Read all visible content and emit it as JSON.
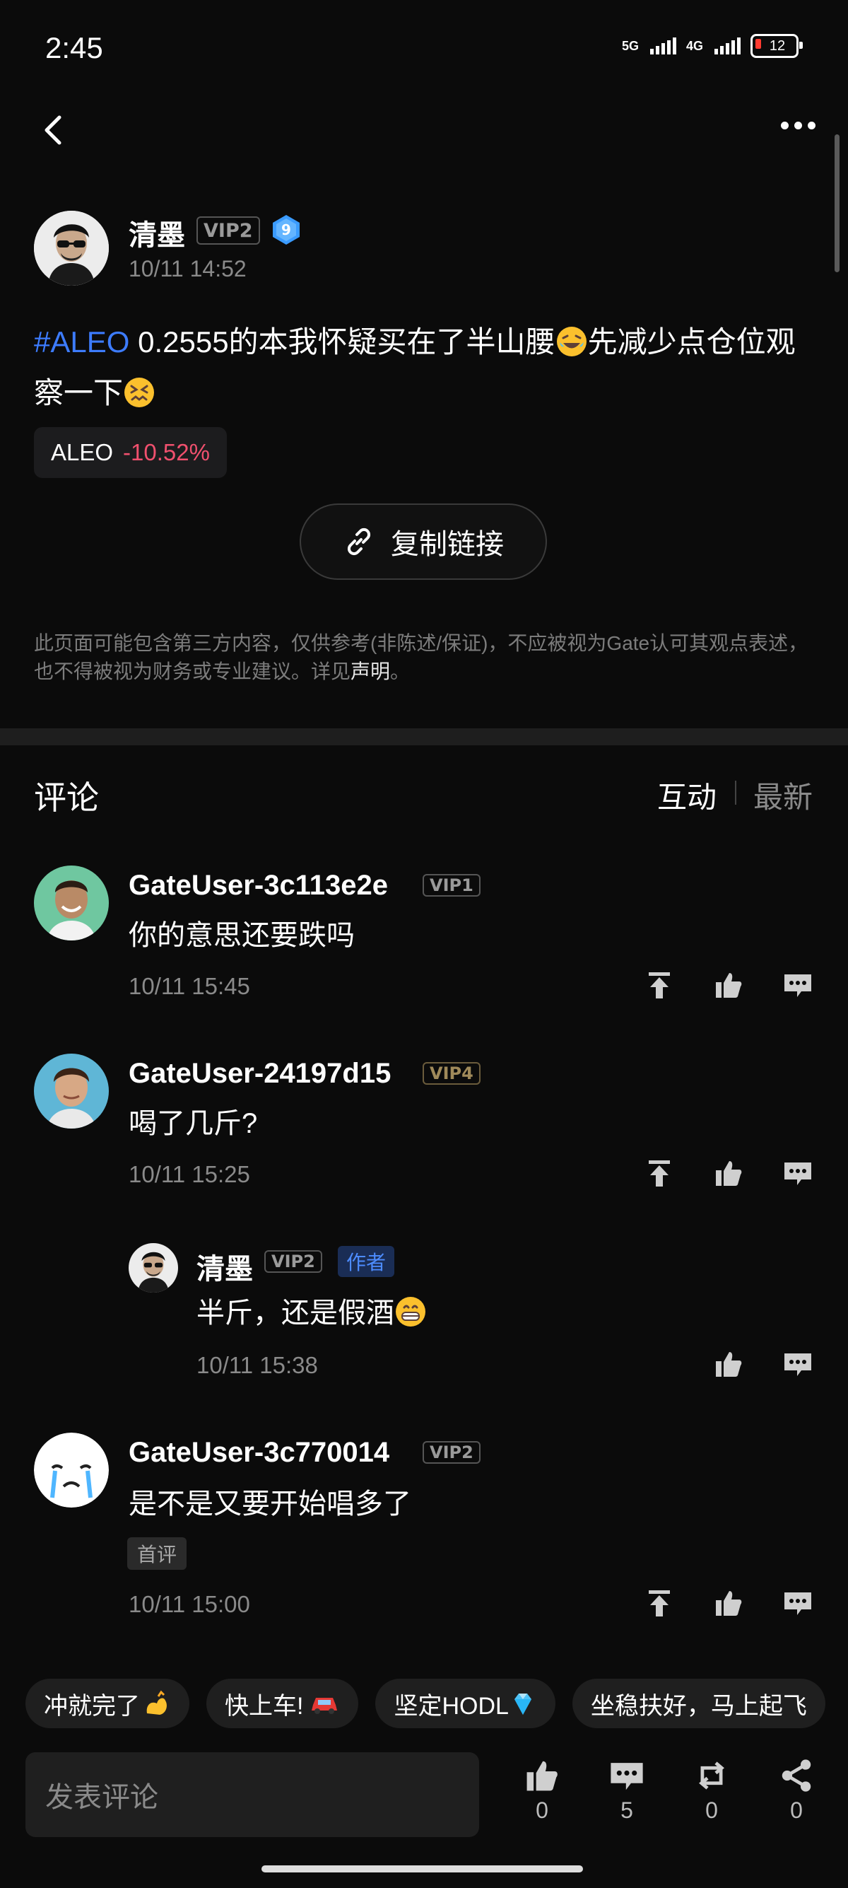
{
  "status": {
    "time": "2:45",
    "net1": "5G",
    "net2": "4G",
    "battery": "12"
  },
  "author": {
    "name": "清墨",
    "vip": "VIP2",
    "level": "9",
    "time": "10/11 14:52"
  },
  "post": {
    "hashtag": "#ALEO",
    "text1": " 0.2555的本我怀疑买在了半山腰",
    "text2": "先减少点仓位观察一下",
    "ticker": "ALEO",
    "change": "-10.52%",
    "copy_link": "复制链接"
  },
  "disclaimer": {
    "text": "此页面可能包含第三方内容，仅供参考(非陈述/保证)，不应被视为Gate认可其观点表述，也不得被视为财务或专业建议。详见",
    "link": "声明",
    "end": "。"
  },
  "comments_section": {
    "title": "评论",
    "sort_hot": "互动",
    "sort_new": "最新"
  },
  "comments": [
    {
      "name": "GateUser-3c113e2e",
      "vip": "VIP1",
      "text": "你的意思还要跌吗",
      "time": "10/11 15:45"
    },
    {
      "name": "GateUser-24197d15",
      "vip": "VIP4",
      "text": "喝了几斤?",
      "time": "10/11 15:25"
    },
    {
      "name": "清墨",
      "vip": "VIP2",
      "author_badge": "作者",
      "text": "半斤，还是假酒",
      "time": "10/11 15:38"
    },
    {
      "name": "GateUser-3c770014",
      "vip": "VIP2",
      "text": "是不是又要开始唱多了",
      "tag": "首评",
      "time": "10/11 15:00"
    }
  ],
  "quick_replies": [
    "冲就完了",
    "快上车!",
    "坚定HODL",
    "坐稳扶好，马上起飞"
  ],
  "bottom_bar": {
    "input_placeholder": "发表评论",
    "like_count": "0",
    "comment_count": "5",
    "repost_count": "0",
    "share_count": "0"
  },
  "colors": {
    "accent": "#3d7cff",
    "negative": "#f0506e",
    "background": "#0b0b0b"
  }
}
